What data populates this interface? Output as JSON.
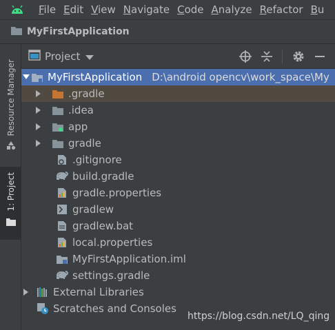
{
  "menu": [
    "File",
    "Edit",
    "View",
    "Navigate",
    "Code",
    "Analyze",
    "Refactor",
    "Bu"
  ],
  "navbar": {
    "project_name": "MyFirstApplication"
  },
  "stripe": {
    "resource_manager": "Resource Manager",
    "project_tab": "1: Project"
  },
  "panel": {
    "title": "Project"
  },
  "tree": {
    "root": {
      "name": "MyFirstApplication",
      "path": "D:\\android opencv\\work_space\\My"
    },
    "items": [
      {
        "name": ".gradle",
        "type": "folder-orange",
        "expandable": true
      },
      {
        "name": ".idea",
        "type": "folder",
        "expandable": true
      },
      {
        "name": "app",
        "type": "folder-module",
        "expandable": true
      },
      {
        "name": "gradle",
        "type": "folder",
        "expandable": true
      },
      {
        "name": ".gitignore",
        "type": "file-ignore",
        "expandable": false
      },
      {
        "name": "build.gradle",
        "type": "gradle-elephant",
        "expandable": false
      },
      {
        "name": "gradle.properties",
        "type": "file-properties",
        "expandable": false
      },
      {
        "name": "gradlew",
        "type": "file-script",
        "expandable": false
      },
      {
        "name": "gradlew.bat",
        "type": "file-text",
        "expandable": false
      },
      {
        "name": "local.properties",
        "type": "file-properties",
        "expandable": false
      },
      {
        "name": "MyFirstApplication.iml",
        "type": "file-iml",
        "expandable": false
      },
      {
        "name": "settings.gradle",
        "type": "gradle-elephant",
        "expandable": false
      }
    ],
    "external_libraries": "External Libraries",
    "scratches": "Scratches and Consoles"
  },
  "watermark": "https://blog.csdn.net/LQ_qing",
  "colors": {
    "selection": "#4b6eaf",
    "hover_row": "#514a40",
    "android_green": "#3ddc84",
    "folder_blue": "#87939a",
    "folder_orange": "#c57633"
  }
}
